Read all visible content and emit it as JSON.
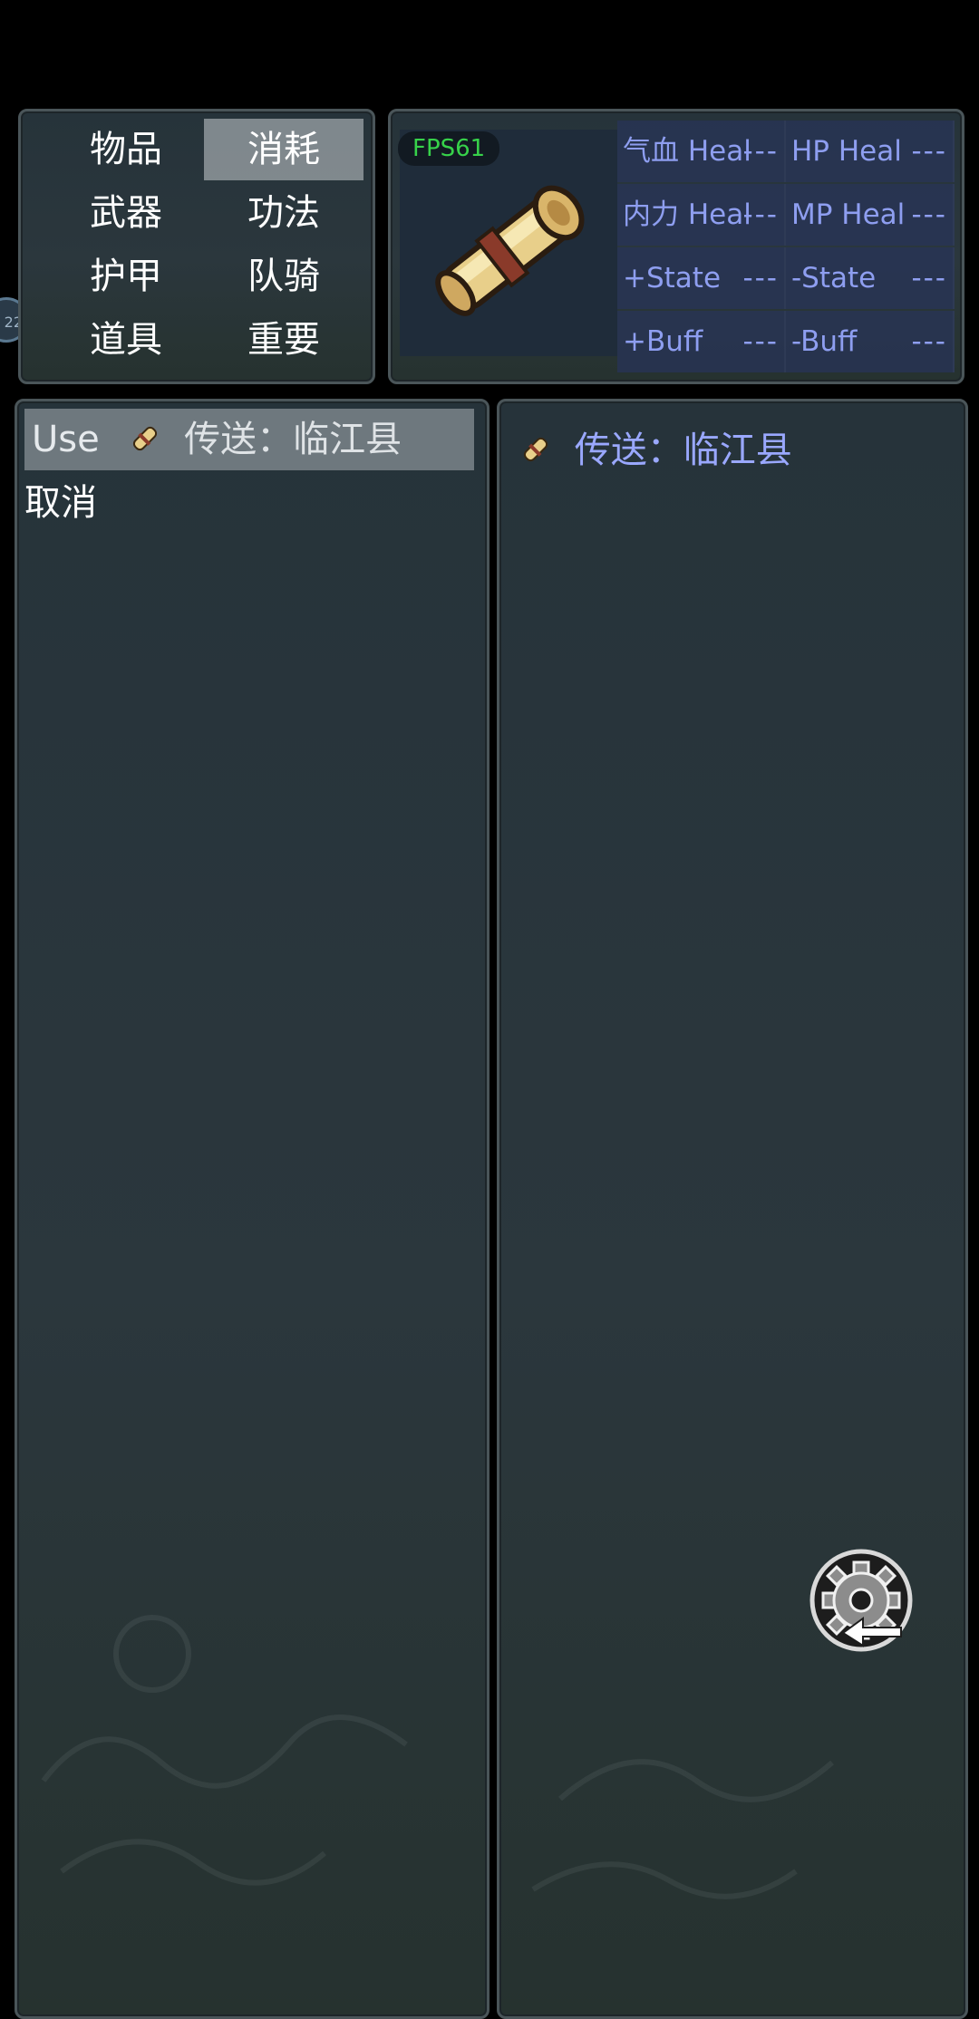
{
  "categories": {
    "items": [
      {
        "label": "物品",
        "selected": false
      },
      {
        "label": "消耗",
        "selected": true
      },
      {
        "label": "武器",
        "selected": false
      },
      {
        "label": "功法",
        "selected": false
      },
      {
        "label": "护甲",
        "selected": false
      },
      {
        "label": "队骑",
        "selected": false
      },
      {
        "label": "道具",
        "selected": false
      },
      {
        "label": "重要",
        "selected": false
      }
    ]
  },
  "info": {
    "fps": "FPS61",
    "item_icon": "scroll-icon",
    "stats": [
      {
        "label": "气血 Heal",
        "value": "---"
      },
      {
        "label": "HP Heal",
        "value": "---"
      },
      {
        "label": "内力 Heal",
        "value": "---"
      },
      {
        "label": "MP Heal",
        "value": "---"
      },
      {
        "label": "+State",
        "value": "---"
      },
      {
        "label": "-State",
        "value": "---"
      },
      {
        "label": "+Buff",
        "value": "---"
      },
      {
        "label": "-Buff",
        "value": "---"
      }
    ]
  },
  "list": {
    "use_label": "Use",
    "selected_item": "传送：临江县",
    "cancel_label": "取消"
  },
  "detail": {
    "title": "传送：临江县"
  },
  "edge_badge": "22",
  "colors": {
    "selected_bg": "#c8cdd2",
    "stat_text": "#8e9ef0",
    "detail_title": "#9aa8ff",
    "fps_text": "#37d24a"
  }
}
